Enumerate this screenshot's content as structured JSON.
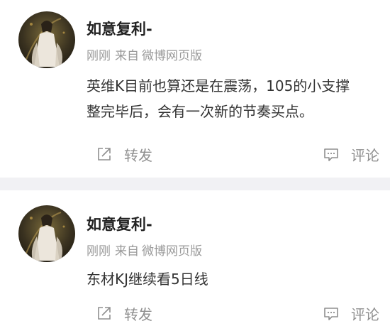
{
  "colors": {
    "username": "#222222",
    "meta": "#9a9a9a",
    "text": "#333333",
    "action": "#8f8f8f",
    "divider": "#f1f1f4"
  },
  "posts": [
    {
      "avatar_icon": "user-avatar",
      "username": "如意复利-",
      "time": "刚刚",
      "source_prefix": "来自",
      "source": "微博网页版",
      "lines": [
        "英维K目前也算还是在震荡，105的小支撑",
        "整完毕后，会有一次新的节奏买点。"
      ],
      "repost_icon": "repost-icon",
      "repost_label": "转发",
      "comment_icon": "comment-icon",
      "comment_label": "评论"
    },
    {
      "avatar_icon": "user-avatar",
      "username": "如意复利-",
      "time": "刚刚",
      "source_prefix": "来自",
      "source": "微博网页版",
      "lines": [
        "东材KJ继续看5日线"
      ],
      "repost_icon": "repost-icon",
      "repost_label": "转发",
      "comment_icon": "comment-icon",
      "comment_label": "评论"
    }
  ]
}
